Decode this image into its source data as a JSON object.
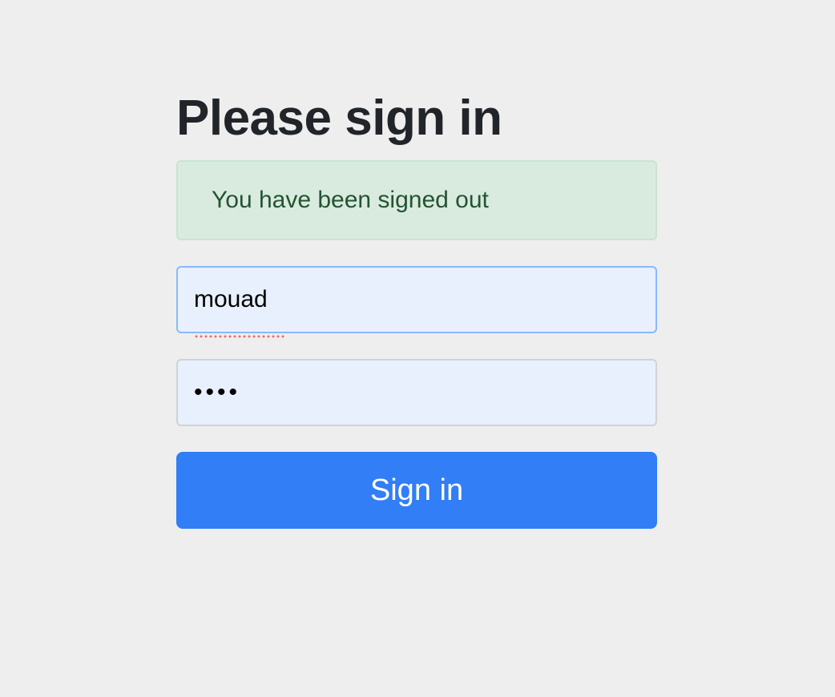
{
  "form": {
    "heading": "Please sign in",
    "alert": "You have been signed out",
    "username": {
      "value": "mouad",
      "spellcheck_flagged": true
    },
    "password": {
      "value": "••••"
    },
    "submit_label": "Sign in"
  },
  "colors": {
    "background": "#eeeeee",
    "alert_bg": "#d9ebde",
    "alert_text": "#245333",
    "input_bg": "#e8f0fe",
    "focus_border": "#8bb8fd",
    "primary": "#317ef6"
  }
}
